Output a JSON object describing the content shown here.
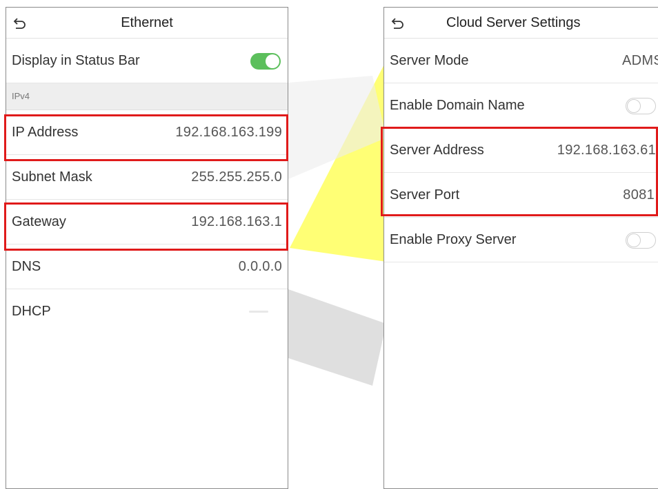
{
  "left_screen": {
    "title": "Ethernet",
    "status_bar": {
      "label": "Display in Status Bar",
      "toggle": "on"
    },
    "section": "IPv4",
    "rows": [
      {
        "label": "IP Address",
        "value": "192.168.163.199"
      },
      {
        "label": "Subnet Mask",
        "value": "255.255.255.0"
      },
      {
        "label": "Gateway",
        "value": "192.168.163.1"
      },
      {
        "label": "DNS",
        "value": "0.0.0.0"
      },
      {
        "label": "DHCP",
        "toggle": "off"
      }
    ]
  },
  "right_screen": {
    "title": "Cloud Server Settings",
    "rows": [
      {
        "label": "Server Mode",
        "value": "ADMS"
      },
      {
        "label": "Enable Domain Name",
        "toggle": "off"
      },
      {
        "label": "Server Address",
        "value": "192.168.163.61"
      },
      {
        "label": "Server Port",
        "value": "8081"
      },
      {
        "label": "Enable Proxy Server",
        "toggle": "off"
      }
    ]
  },
  "colors": {
    "highlight": "#e01a1a",
    "toggle_on": "#5cbf5c",
    "watermark": "#ffff66"
  },
  "icons": [
    "back-arrow-icon"
  ]
}
